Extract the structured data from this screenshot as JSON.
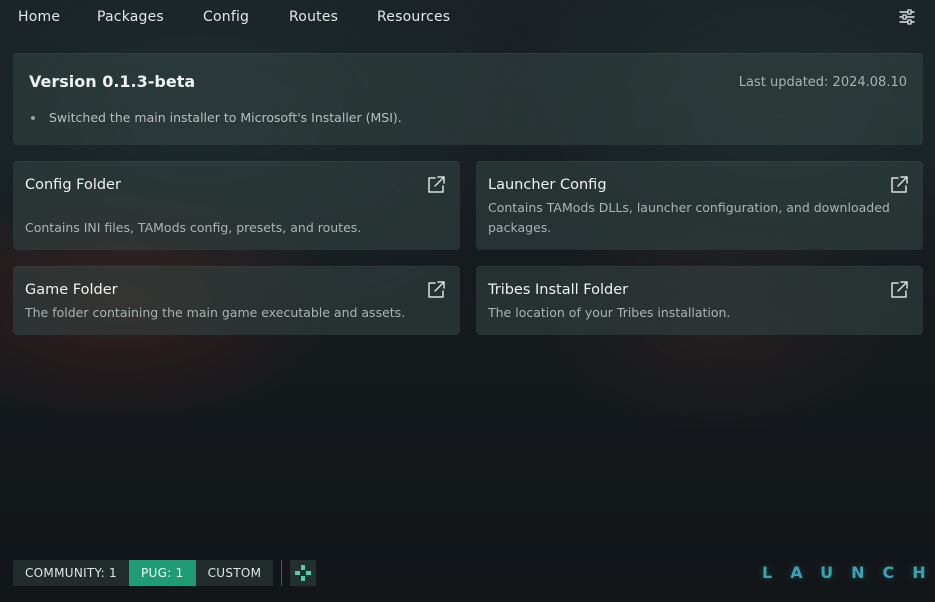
{
  "nav": {
    "items": [
      "Home",
      "Packages",
      "Config",
      "Routes",
      "Resources"
    ],
    "settings_icon": "sliders-icon"
  },
  "version": {
    "title": "Version 0.1.3-beta",
    "last_updated": "Last updated: 2024.08.10",
    "changes": [
      "Switched the main installer to Microsoft's Installer (MSI)."
    ]
  },
  "cards": [
    {
      "title": "Config Folder",
      "description": "Contains INI files, TAMods config, presets, and routes.",
      "icon": "external-link-icon"
    },
    {
      "title": "Launcher Config",
      "description": "Contains TAMods DLLs, launcher configuration, and downloaded packages.",
      "icon": "external-link-icon"
    },
    {
      "title": "Game Folder",
      "description": "The folder containing the main game executable and assets.",
      "icon": "external-link-icon"
    },
    {
      "title": "Tribes Install Folder",
      "description": "The location of your Tribes installation.",
      "icon": "external-link-icon"
    }
  ],
  "bottom": {
    "community": "COMMUNITY: 1",
    "pug": "PUG: 1",
    "custom": "CUSTOM",
    "gamepad_icon": "gamepad-icon",
    "launch": "LAUNCH"
  },
  "colors": {
    "accent": "#1f9c73",
    "launch": "#3aa3b3",
    "gamepad": "#4fd1a5"
  }
}
